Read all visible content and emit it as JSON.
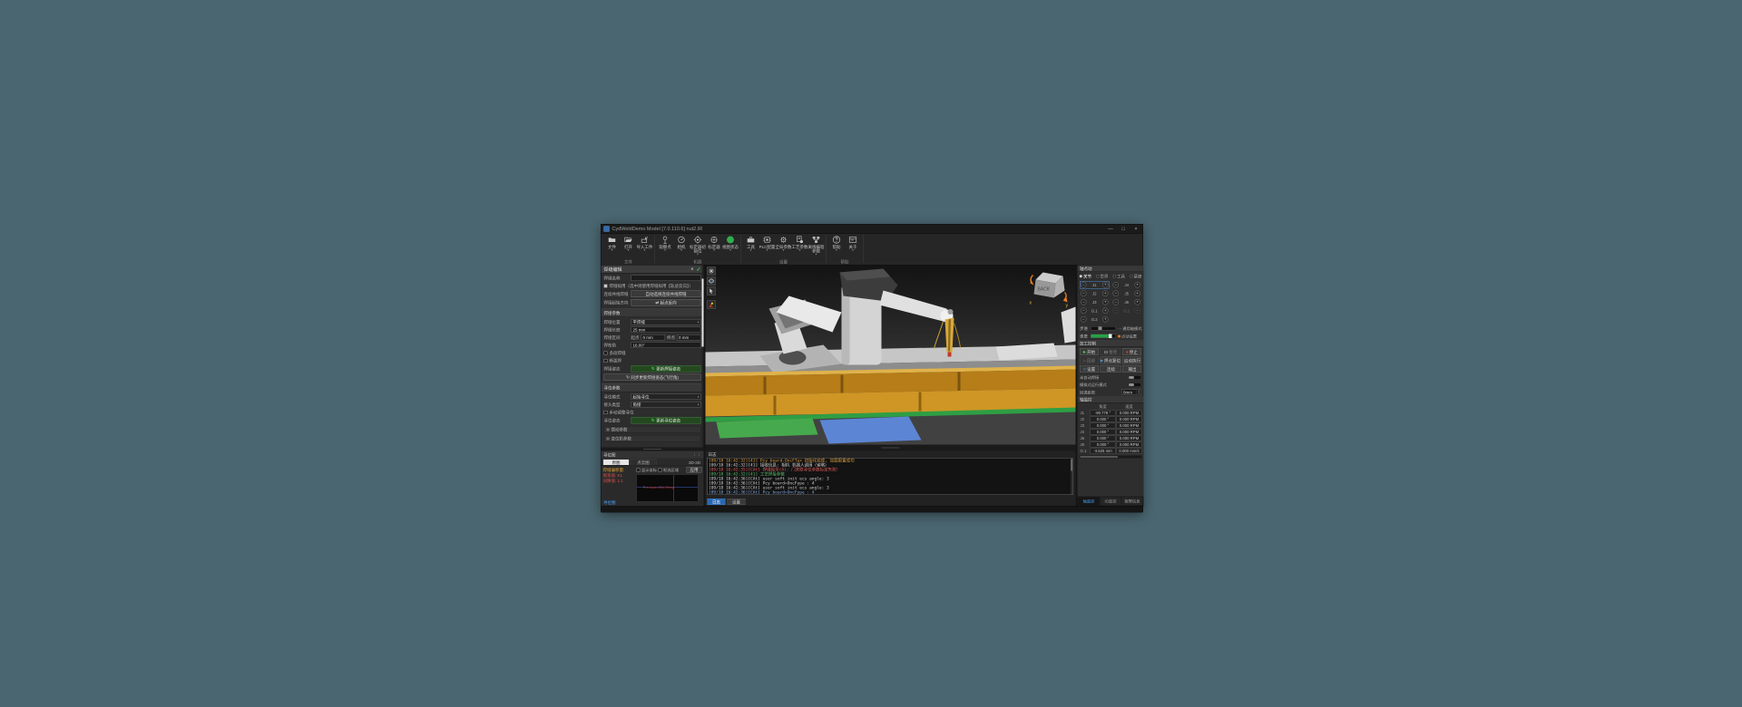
{
  "window": {
    "title": "CydWeldDemo Model [7.0.110.6] nut2.IR",
    "minimize": "—",
    "maximize": "□",
    "close": "×"
  },
  "glyphs": {
    "caret": "▾",
    "close": "×",
    "check": "✓",
    "swap": "⇄",
    "refresh": "↻",
    "play": "▶",
    "pause": "▮▮",
    "stop": "■",
    "gear": "⊙",
    "minus": "−",
    "plus": "+",
    "up": "▲",
    "down": "▼",
    "dots": "⋮⋮",
    "step_prefix": "···"
  },
  "ribbon": {
    "groups": [
      {
        "label": "文件",
        "items": [
          {
            "label": "文件"
          },
          {
            "label": "打开"
          },
          {
            "label": "导入工件"
          }
        ]
      },
      {
        "label": "机器",
        "items": [
          {
            "label": "观察点"
          },
          {
            "label": "相机"
          },
          {
            "label": "标定器初始位"
          },
          {
            "label": "标定器"
          },
          {
            "label": "视图状态"
          }
        ]
      },
      {
        "label": "设置",
        "items": [
          {
            "label": "工具"
          },
          {
            "label": "PLC配置"
          },
          {
            "label": "全局参数"
          },
          {
            "label": "工艺参数"
          },
          {
            "label": "离线编程参数"
          }
        ]
      },
      {
        "label": "帮助",
        "items": [
          {
            "label": "帮助"
          },
          {
            "label": "关于"
          }
        ]
      }
    ]
  },
  "weld_panel": {
    "title": "焊缝编辑",
    "name_label": "焊缝名称",
    "name_value": "",
    "reverse_check": "焊缝拟用（选中则使用焊缝拟用【轨迹反向】）",
    "colinear_label": "连续共线焊缝",
    "colinear_button": "自动选择连续共线焊缝",
    "start_dir_label": "焊接起始方向",
    "start_dir_button": "起点反向",
    "weld_params_title": "焊接参数",
    "pos_label": "焊缝位置",
    "pos_value": "平焊缝",
    "len_label": "焊缝长度",
    "len_value": "25 mm",
    "range_label": "焊接区间",
    "range_start_label": "起点",
    "range_start": "0 mm",
    "range_end_label": "终点",
    "range_end": "0 mm",
    "angle_label": "焊枪角",
    "angle_value": "16.00°",
    "multi_check": "多段焊缝",
    "arc_check": "断弧焊",
    "pose_label": "焊接姿态",
    "pose_button": "更新焊接姿态",
    "sync_button": "同步更新焊接姿态(飞行角)",
    "locate_title": "寻位参数",
    "mode_label": "寻位模式",
    "mode_value": "起始寻位",
    "joint_label": "接头类型",
    "joint_value": "角接",
    "manual_check": "手动调整寻位",
    "locate_pose_label": "寻位姿态",
    "locate_pose_button": "更新寻位姿态",
    "collapsed": [
      {
        "label": "摆动参数"
      },
      {
        "label": "变位机参数"
      }
    ]
  },
  "locator_panel": {
    "title": "寻位图",
    "tabs": [
      {
        "label": "原图",
        "cls": "on"
      },
      {
        "label": "点云图"
      }
    ],
    "corner": "3D-2D",
    "readouts": [
      {
        "text": "焊缝偏移量:",
        "cls": "o"
      },
      {
        "text": "熔宽值: K1"
      },
      {
        "text": "间隙值: 1.1"
      }
    ],
    "show_check": "显示坐标",
    "range_check": "框选区域",
    "apply": "应用",
    "canvas_label": "Pre-scan-Rbt-Temp",
    "footer": "寻位图"
  },
  "viewport": {
    "navcube_label": "BACK",
    "axis_x": "x",
    "axis_y": "y"
  },
  "log_panel": {
    "title": "日志",
    "lines": [
      {
        "text": "[09/18 16:42:32][41] Pcy board-OncFTax 初始化完成, 加载配置成功",
        "cls": "c-or"
      },
      {
        "text": "[09/18 16:42:32][41] 接收信息: 相机 机器人调用（省略）",
        "cls": "c-wh"
      },
      {
        "text": "[09/18 16:42:35][CAt] 焊缝接号(4): 门关联寻位参数标定失败！",
        "cls": "c-rd"
      },
      {
        "text": "[09/18 16:42:32][41] 工艺焊接参数",
        "cls": "c-gr"
      },
      {
        "text": "[09/18 16:42:36][CAt] user soft init ecs angle: 3",
        "cls": "c-wh"
      },
      {
        "text": "[09/18 16:42:36][CAt] Pcy board=OncFype : 4",
        "cls": "c-wh"
      },
      {
        "text": "[09/18 16:42:36][CAt] user soft init ecs angle: 3",
        "cls": "c-wh"
      },
      {
        "text": "[09/18 16:42:36][CAt] Pcy board=OncFype : 4",
        "cls": "c-bl"
      }
    ],
    "log_button": "日志",
    "settings_button": "设置"
  },
  "jog_panel": {
    "title": "轴点动",
    "modes": [
      {
        "label": "关节",
        "cls": "on"
      },
      {
        "label": "世界"
      },
      {
        "label": "工具"
      },
      {
        "label": "基座"
      }
    ],
    "axes": [
      {
        "label": "J1",
        "cls": "focus"
      },
      {
        "label": "J4"
      },
      {
        "label": "J2"
      },
      {
        "label": "J5"
      },
      {
        "label": "J3"
      },
      {
        "label": "J6"
      },
      {
        "label": "G.1"
      },
      {
        "label": "G.1",
        "cls": "dim"
      },
      {
        "label": "G.2"
      }
    ],
    "step_label": "步进",
    "axis_mode_label": "通用轴模式",
    "speed_label": "速度",
    "jog_setting_label": "点动设置",
    "control_title": "加工控制",
    "ctl_buttons": [
      {
        "label": "开始",
        "ic": "▶",
        "cls": "start"
      },
      {
        "label": "暂停",
        "ic": "▮▮",
        "cls": "dim"
      },
      {
        "label": "停止",
        "ic": "■",
        "cls": "stop"
      },
      {
        "label": "回退",
        "ic": "▷",
        "cls": "dim"
      },
      {
        "label": "焊点复位",
        "ic": "▶",
        "cls": "blue"
      },
      {
        "label": "启动执行",
        "ic": ""
      },
      {
        "label": "设置",
        "ic": "⊙",
        "cls": "blue"
      },
      {
        "label": "连续",
        "ic": ""
      },
      {
        "label": "输出",
        "ic": ""
      }
    ],
    "toggles": [
      {
        "label": "半自动焊接"
      },
      {
        "label": "模拟式运行模式"
      }
    ],
    "retreat_label": "回退距离",
    "retreat_value": "0mm",
    "monitor_title": "轴监控",
    "col_angle": "角度",
    "col_speed": "速度",
    "axes_table": [
      {
        "axis": "J1",
        "val": "-90.778 °",
        "speed": "0.000 RPM",
        "cls": "sel"
      },
      {
        "axis": "J2",
        "val": "0.000 °",
        "speed": "0.000 RPM"
      },
      {
        "axis": "J3",
        "val": "0.000 °",
        "speed": "0.000 RPM"
      },
      {
        "axis": "J4",
        "val": "0.000 °",
        "speed": "0.000 RPM"
      },
      {
        "axis": "J5",
        "val": "0.000 °",
        "speed": "0.000 RPM"
      },
      {
        "axis": "J6",
        "val": "0.000 °",
        "speed": "0.000 RPM"
      },
      {
        "axis": "G.1",
        "val": "-3.525 mm",
        "speed": "0.000 mm/s"
      }
    ],
    "tabs": [
      {
        "label": "轴监控",
        "cls": "on"
      },
      {
        "label": "IO监控"
      },
      {
        "label": "报警信息"
      }
    ]
  }
}
